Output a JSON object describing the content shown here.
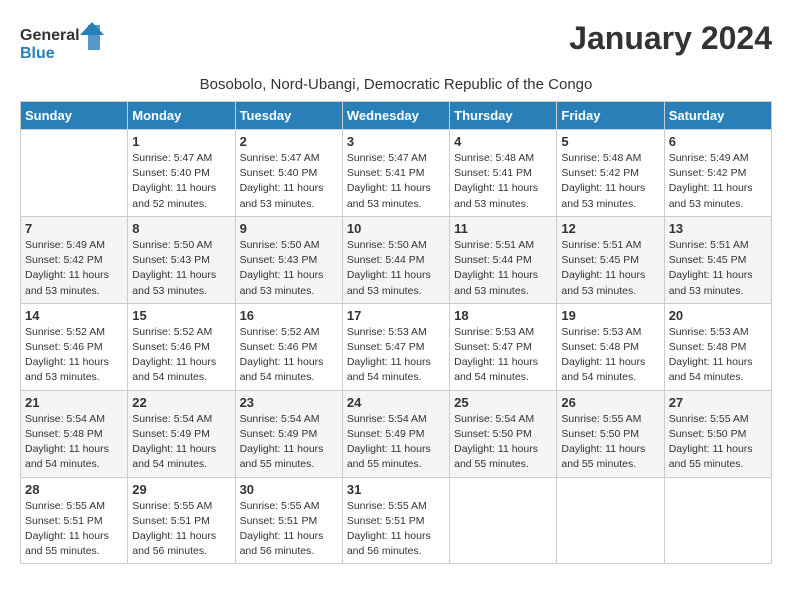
{
  "logo": {
    "general": "General",
    "blue": "Blue"
  },
  "title": "January 2024",
  "subtitle": "Bosobolo, Nord-Ubangi, Democratic Republic of the Congo",
  "days_of_week": [
    "Sunday",
    "Monday",
    "Tuesday",
    "Wednesday",
    "Thursday",
    "Friday",
    "Saturday"
  ],
  "weeks": [
    [
      {
        "day": "",
        "info": ""
      },
      {
        "day": "1",
        "info": "Sunrise: 5:47 AM\nSunset: 5:40 PM\nDaylight: 11 hours\nand 52 minutes."
      },
      {
        "day": "2",
        "info": "Sunrise: 5:47 AM\nSunset: 5:40 PM\nDaylight: 11 hours\nand 53 minutes."
      },
      {
        "day": "3",
        "info": "Sunrise: 5:47 AM\nSunset: 5:41 PM\nDaylight: 11 hours\nand 53 minutes."
      },
      {
        "day": "4",
        "info": "Sunrise: 5:48 AM\nSunset: 5:41 PM\nDaylight: 11 hours\nand 53 minutes."
      },
      {
        "day": "5",
        "info": "Sunrise: 5:48 AM\nSunset: 5:42 PM\nDaylight: 11 hours\nand 53 minutes."
      },
      {
        "day": "6",
        "info": "Sunrise: 5:49 AM\nSunset: 5:42 PM\nDaylight: 11 hours\nand 53 minutes."
      }
    ],
    [
      {
        "day": "7",
        "info": "Sunrise: 5:49 AM\nSunset: 5:42 PM\nDaylight: 11 hours\nand 53 minutes."
      },
      {
        "day": "8",
        "info": "Sunrise: 5:50 AM\nSunset: 5:43 PM\nDaylight: 11 hours\nand 53 minutes."
      },
      {
        "day": "9",
        "info": "Sunrise: 5:50 AM\nSunset: 5:43 PM\nDaylight: 11 hours\nand 53 minutes."
      },
      {
        "day": "10",
        "info": "Sunrise: 5:50 AM\nSunset: 5:44 PM\nDaylight: 11 hours\nand 53 minutes."
      },
      {
        "day": "11",
        "info": "Sunrise: 5:51 AM\nSunset: 5:44 PM\nDaylight: 11 hours\nand 53 minutes."
      },
      {
        "day": "12",
        "info": "Sunrise: 5:51 AM\nSunset: 5:45 PM\nDaylight: 11 hours\nand 53 minutes."
      },
      {
        "day": "13",
        "info": "Sunrise: 5:51 AM\nSunset: 5:45 PM\nDaylight: 11 hours\nand 53 minutes."
      }
    ],
    [
      {
        "day": "14",
        "info": "Sunrise: 5:52 AM\nSunset: 5:46 PM\nDaylight: 11 hours\nand 53 minutes."
      },
      {
        "day": "15",
        "info": "Sunrise: 5:52 AM\nSunset: 5:46 PM\nDaylight: 11 hours\nand 54 minutes."
      },
      {
        "day": "16",
        "info": "Sunrise: 5:52 AM\nSunset: 5:46 PM\nDaylight: 11 hours\nand 54 minutes."
      },
      {
        "day": "17",
        "info": "Sunrise: 5:53 AM\nSunset: 5:47 PM\nDaylight: 11 hours\nand 54 minutes."
      },
      {
        "day": "18",
        "info": "Sunrise: 5:53 AM\nSunset: 5:47 PM\nDaylight: 11 hours\nand 54 minutes."
      },
      {
        "day": "19",
        "info": "Sunrise: 5:53 AM\nSunset: 5:48 PM\nDaylight: 11 hours\nand 54 minutes."
      },
      {
        "day": "20",
        "info": "Sunrise: 5:53 AM\nSunset: 5:48 PM\nDaylight: 11 hours\nand 54 minutes."
      }
    ],
    [
      {
        "day": "21",
        "info": "Sunrise: 5:54 AM\nSunset: 5:48 PM\nDaylight: 11 hours\nand 54 minutes."
      },
      {
        "day": "22",
        "info": "Sunrise: 5:54 AM\nSunset: 5:49 PM\nDaylight: 11 hours\nand 54 minutes."
      },
      {
        "day": "23",
        "info": "Sunrise: 5:54 AM\nSunset: 5:49 PM\nDaylight: 11 hours\nand 55 minutes."
      },
      {
        "day": "24",
        "info": "Sunrise: 5:54 AM\nSunset: 5:49 PM\nDaylight: 11 hours\nand 55 minutes."
      },
      {
        "day": "25",
        "info": "Sunrise: 5:54 AM\nSunset: 5:50 PM\nDaylight: 11 hours\nand 55 minutes."
      },
      {
        "day": "26",
        "info": "Sunrise: 5:55 AM\nSunset: 5:50 PM\nDaylight: 11 hours\nand 55 minutes."
      },
      {
        "day": "27",
        "info": "Sunrise: 5:55 AM\nSunset: 5:50 PM\nDaylight: 11 hours\nand 55 minutes."
      }
    ],
    [
      {
        "day": "28",
        "info": "Sunrise: 5:55 AM\nSunset: 5:51 PM\nDaylight: 11 hours\nand 55 minutes."
      },
      {
        "day": "29",
        "info": "Sunrise: 5:55 AM\nSunset: 5:51 PM\nDaylight: 11 hours\nand 56 minutes."
      },
      {
        "day": "30",
        "info": "Sunrise: 5:55 AM\nSunset: 5:51 PM\nDaylight: 11 hours\nand 56 minutes."
      },
      {
        "day": "31",
        "info": "Sunrise: 5:55 AM\nSunset: 5:51 PM\nDaylight: 11 hours\nand 56 minutes."
      },
      {
        "day": "",
        "info": ""
      },
      {
        "day": "",
        "info": ""
      },
      {
        "day": "",
        "info": ""
      }
    ]
  ]
}
